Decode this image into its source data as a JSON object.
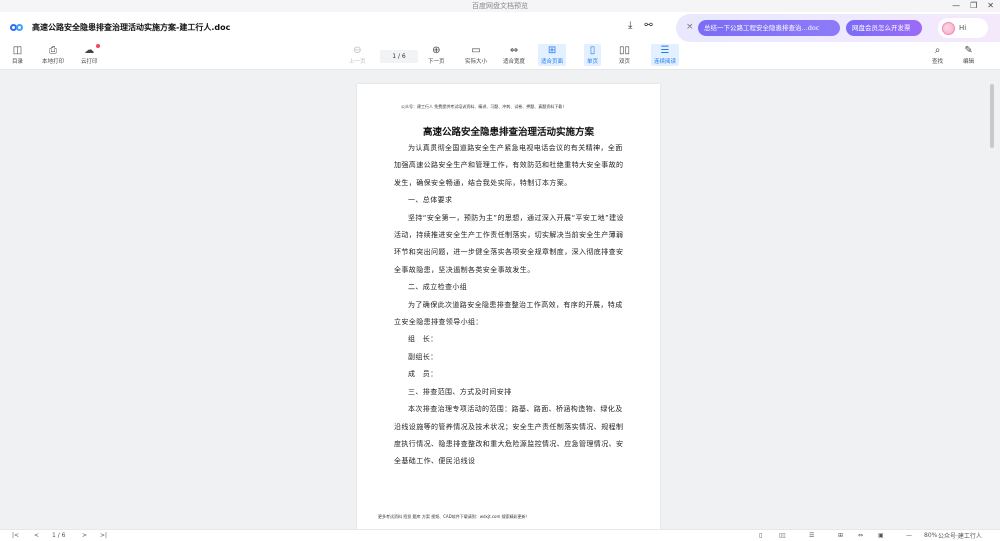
{
  "window": {
    "title": "百度网盘文档预览",
    "controls": {
      "minimize": "—",
      "restore": "❐",
      "close": "✕"
    }
  },
  "header": {
    "doc_title": "高速公路安全隐患排查治理活动实施方案-建工行人.doc",
    "download_icon": "download-icon",
    "share_icon": "share-icon"
  },
  "ai_panel": {
    "close": "×",
    "pill_summary": "总结一下公路工程安全隐患排查治...doc",
    "pill_vip": "网盘会员怎么开发票",
    "hi": "Hi"
  },
  "toolbar": {
    "toc": "目录",
    "local_print": "本地打印",
    "cloud_print": "云打印",
    "prev_page": "上一页",
    "page_indicator": "1 / 6",
    "next_page": "下一页",
    "actual_size": "实际大小",
    "fit_width": "适合宽度",
    "fit_page": "适合页面",
    "single_page": "单页",
    "double_page": "双页",
    "continuous": "连续阅读",
    "find": "查找",
    "edit": "编辑"
  },
  "document": {
    "header_note": "公众号：建工行人  免费提供考试培训资料、精讲、习题、冲刺、试卷、押题、真题资料下载！",
    "title": "高速公路安全隐患排查治理活动实施方案",
    "paragraphs": [
      "为认真贯彻全国道路安全生产紧急电视电话会议的有关精神，全面加强高速公路安全生产和管理工作，有效防范和杜绝重特大安全事故的发生，确保安全畅通，结合我处实际，特制订本方案。",
      "一、总体要求",
      "坚持“安全第一，预防为主”的思想，通过深入开展“平安工地”建设活动，持续推进安全生产工作责任制落实，切实解决当前安全生产薄弱环节和突出问题，进一步健全落实各项安全规章制度，深入彻底排查安全事故隐患，坚决遏制各类安全事故发生。",
      "二、成立检查小组",
      "为了确保此次道路安全隐患排查整治工作高效，有序的开展，特成立安全隐患排查领导小组：",
      "组　长：",
      "副组长：",
      "成　员：",
      "三、排查范围、方式及时间安排",
      "本次排查治理专项活动的范围：路基、路面、桥涵构造物、绿化及沿线设施等的管养情况及技术状况；安全生产责任制落实情况、规程制度执行情况、隐患排查整改和重大危险源监控情况、应急管理情况、安全基础工作、便民沿线设"
    ],
    "footnote": "更多考试资料 招投 题库 方案 视频、CAD软件下载请到：wdxjt.com 搜索精彩更新！"
  },
  "statusbar": {
    "first": "|<",
    "prev": "<",
    "page": "1 / 6",
    "next": ">",
    "last": ">|",
    "zoom_out": "—",
    "zoom": "80%",
    "watermark": "公众号·建工行人"
  }
}
